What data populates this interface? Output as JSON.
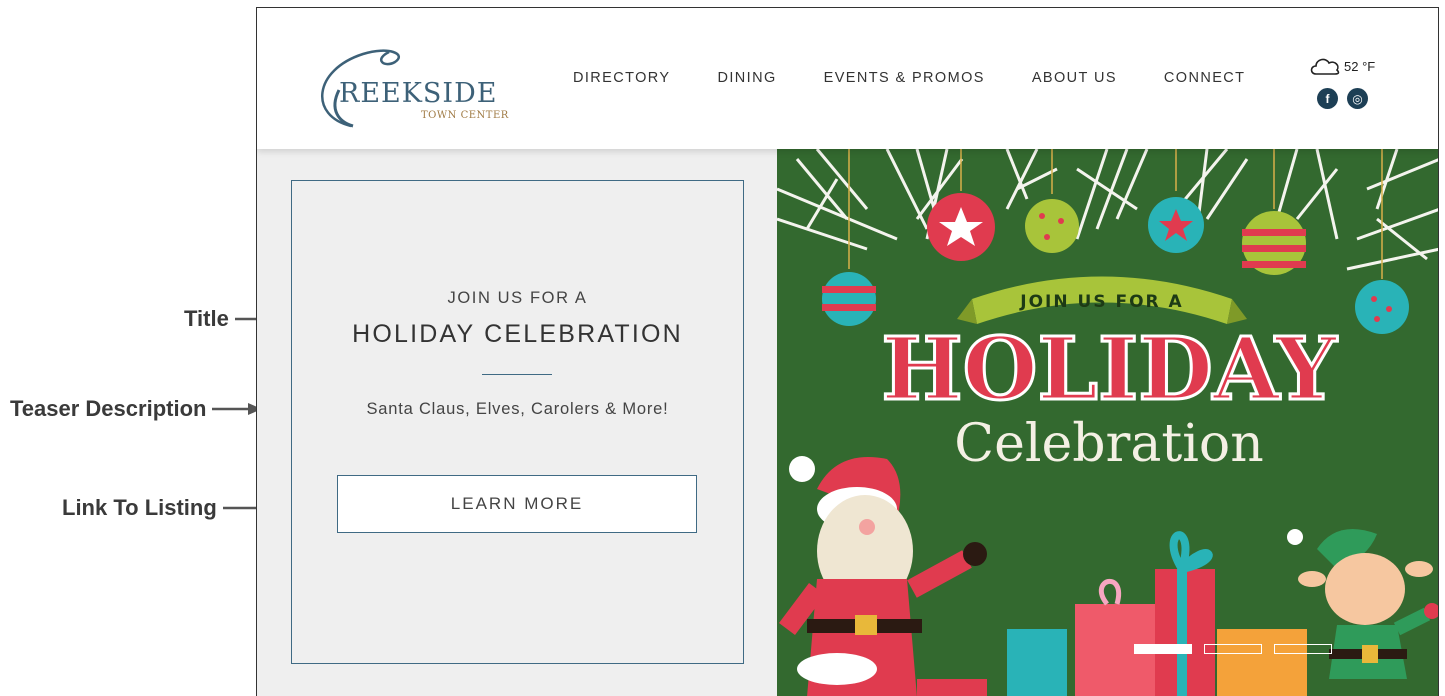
{
  "annotations": {
    "title": "Title",
    "teaser": "Teaser Description",
    "link": "Link To Listing"
  },
  "logo": {
    "main": "REEKSIDE",
    "sub": "TOWN CENTER"
  },
  "nav": {
    "items": [
      "DIRECTORY",
      "DINING",
      "EVENTS & PROMOS",
      "ABOUT US",
      "CONNECT"
    ]
  },
  "weather": {
    "temp": "52 °F",
    "icon": "cloud-icon"
  },
  "social": {
    "facebook": "f",
    "instagram": "◎"
  },
  "card": {
    "eyebrow": "JOIN US FOR A",
    "title": "HOLIDAY CELEBRATION",
    "teaser": "Santa Claus, Elves, Carolers & More!",
    "button": "LEARN MORE"
  },
  "hero": {
    "ribbon": "JOIN US FOR A",
    "headline": "HOLIDAY",
    "subheadline": "Celebration",
    "slides": 3,
    "active_slide": 1
  },
  "colors": {
    "accent": "#3f6a84",
    "hero_bg": "#33692f",
    "headline_red": "#e03b4f",
    "ribbon_green": "#a8c43a"
  }
}
